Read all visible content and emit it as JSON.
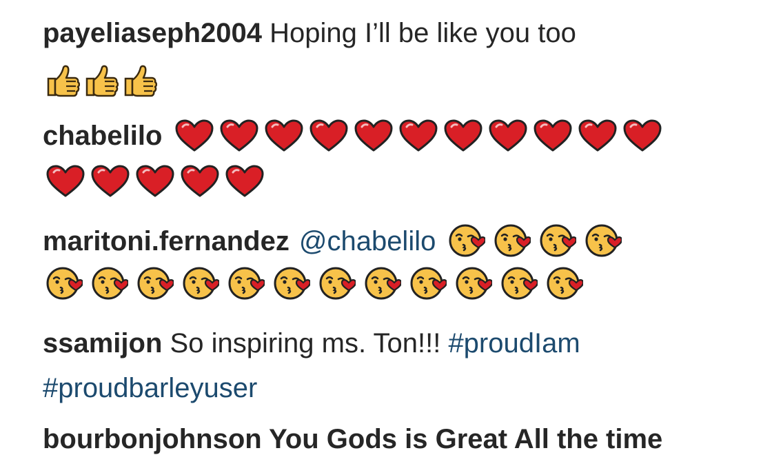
{
  "comments": [
    {
      "username": "payeliaseph2004",
      "text": "Hoping I’ll be like you too",
      "emojis": {
        "name": "thumbs-up-icon",
        "count": 3
      }
    },
    {
      "username": "chabelilo",
      "emojis": {
        "name": "red-heart-icon",
        "count_line1": 11,
        "count_line2": 5
      }
    },
    {
      "username": "maritoni.fernandez",
      "mention": "@chabelilo",
      "emojis": {
        "name": "kissing-face-icon",
        "count_line1": 4,
        "count_line2": 12
      }
    },
    {
      "username": "ssamijon",
      "text": "So inspiring ms. Ton!!!",
      "hashtags": [
        "#proudIam",
        "#proudbarleyuser"
      ]
    }
  ],
  "partial_comment": "bourbonjohnson You Gods is Great All the time",
  "colors": {
    "text": "#262626",
    "link": "#1c4a6e",
    "heart": "#d91f26",
    "emoji_face": "#f7c24a"
  }
}
